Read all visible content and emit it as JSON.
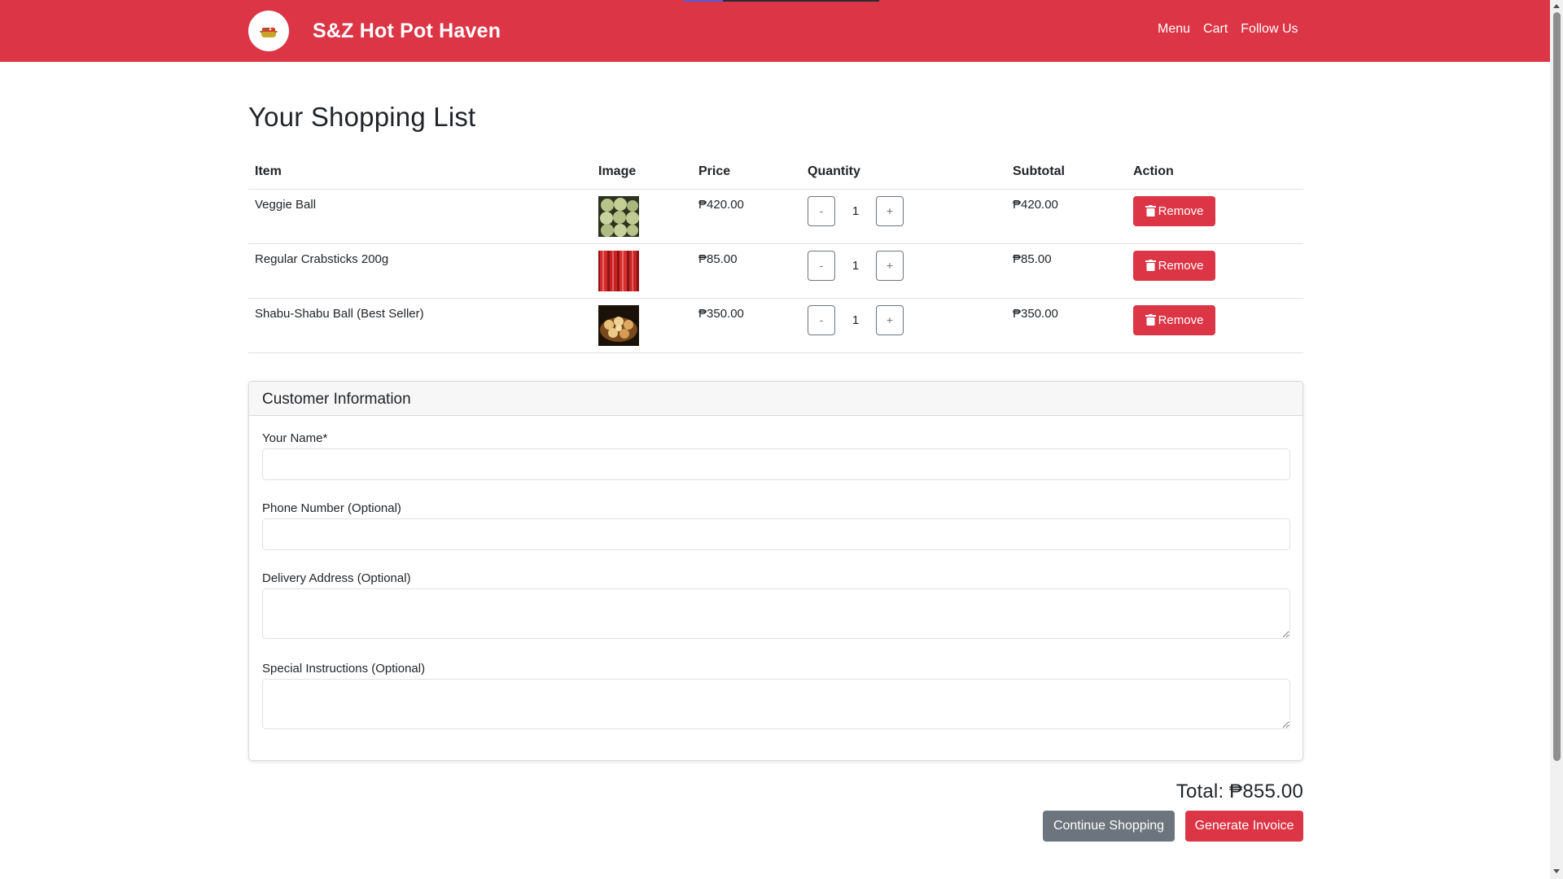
{
  "header": {
    "brand": "S&Z Hot Pot Haven",
    "nav": [
      "Menu",
      "Cart",
      "Follow Us"
    ]
  },
  "page": {
    "title": "Your Shopping List"
  },
  "table": {
    "columns": [
      "Item",
      "Image",
      "Price",
      "Quantity",
      "Subtotal",
      "Action"
    ],
    "rows": [
      {
        "item": "Veggie Ball",
        "image": "veggie-ball",
        "price": "₱420.00",
        "quantity": "1",
        "subtotal": "₱420.00",
        "action": "Remove"
      },
      {
        "item": "Regular Crabsticks 200g",
        "image": "crabsticks",
        "price": "₱85.00",
        "quantity": "1",
        "subtotal": "₱85.00",
        "action": "Remove"
      },
      {
        "item": "Shabu-Shabu Ball (Best Seller)",
        "image": "shabu-ball",
        "price": "₱350.00",
        "quantity": "1",
        "subtotal": "₱350.00",
        "action": "Remove"
      }
    ],
    "qty_minus": "-",
    "qty_plus": "+"
  },
  "customer": {
    "title": "Customer Information",
    "fields": {
      "name_label": "Your Name*",
      "name_value": "",
      "phone_label": "Phone Number (Optional)",
      "phone_value": "",
      "address_label": "Delivery Address (Optional)",
      "address_value": "",
      "instructions_label": "Special Instructions (Optional)",
      "instructions_value": ""
    }
  },
  "summary": {
    "total": "Total: ₱855.00",
    "continue_label": "Continue Shopping",
    "invoice_label": "Generate Invoice"
  },
  "colors": {
    "brand": "#dc3545",
    "secondary": "#6c757d"
  }
}
